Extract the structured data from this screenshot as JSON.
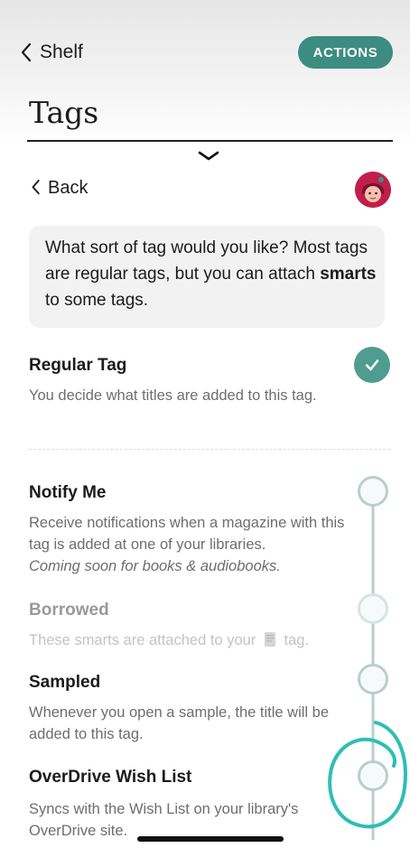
{
  "nav": {
    "back_label": "Shelf",
    "actions_label": "ACTIONS"
  },
  "page": {
    "title": "Tags"
  },
  "panel": {
    "back_label": "Back",
    "prompt_before": "What sort of tag would you like? Most tags are regular tags, but you can attach ",
    "prompt_bold": "smarts",
    "prompt_after": " to some tags."
  },
  "options": {
    "regular": {
      "title": "Regular Tag",
      "desc": "You decide what titles are added to this tag."
    },
    "notify": {
      "title": "Notify Me",
      "desc": "Receive notifications when a magazine with this tag is added at one of your libraries.",
      "note": "Coming soon for books & audiobooks."
    },
    "borrowed": {
      "title": "Borrowed",
      "desc_before": "These smarts are attached to your",
      "desc_after": "tag."
    },
    "sampled": {
      "title": "Sampled",
      "desc": "Whenever you open a sample, the title will be added to this tag."
    },
    "wishlist": {
      "title": "OverDrive Wish List",
      "desc": "Syncs with the Wish List on your library's OverDrive site."
    }
  },
  "colors": {
    "accent": "#3d8c81",
    "check": "#4f9c90",
    "annotation": "#2bbfb3",
    "avatar": "#c01f4b"
  }
}
